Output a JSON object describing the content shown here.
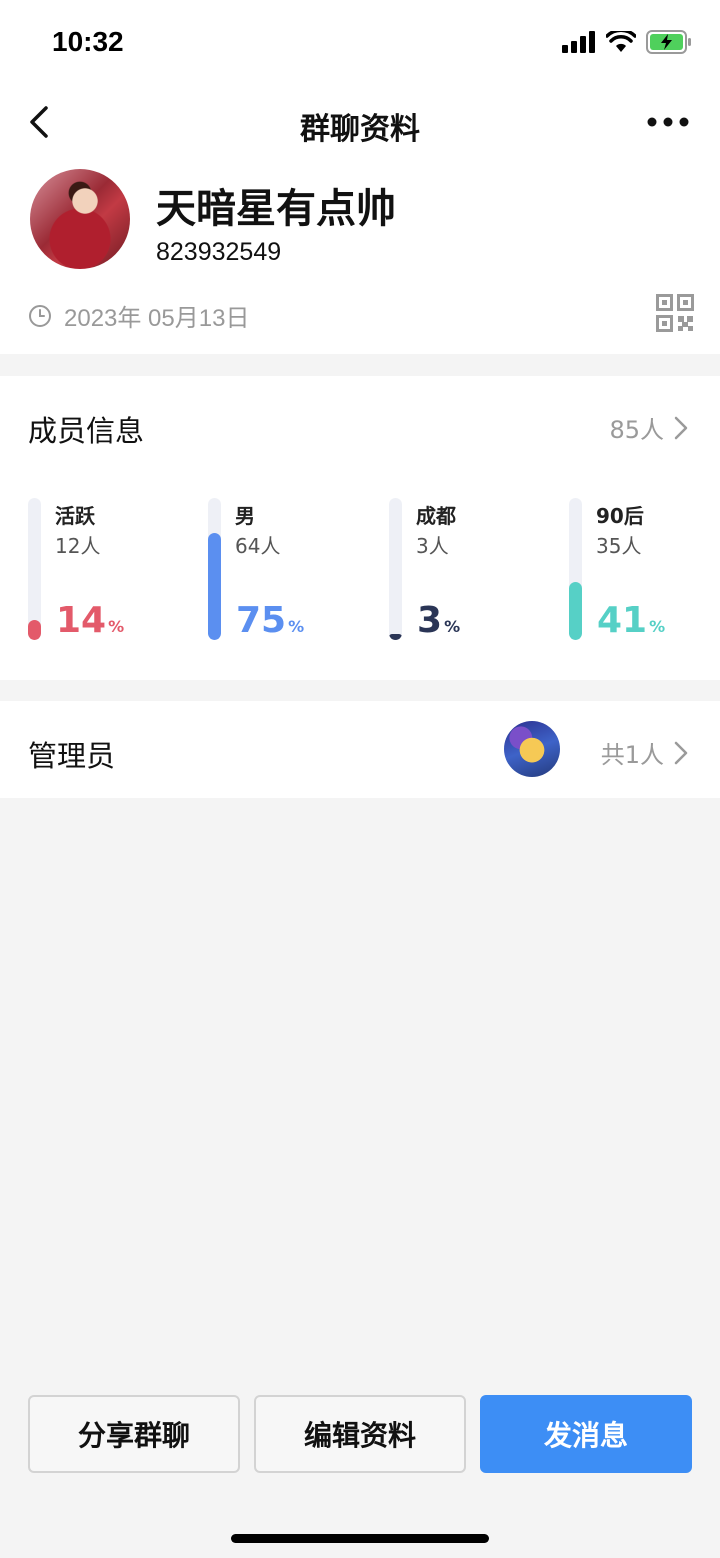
{
  "status_bar": {
    "time": "10:32"
  },
  "nav": {
    "title": "群聊资料"
  },
  "profile": {
    "name": "天暗星有点帅",
    "group_id": "823932549",
    "created_date": "2023年 05月13日"
  },
  "members": {
    "title": "成员信息",
    "count_label": "85人",
    "stats": [
      {
        "label": "活跃",
        "count": "12人",
        "percent": "14",
        "value": 0.14,
        "color": "#e35a6a"
      },
      {
        "label": "男",
        "count": "64人",
        "percent": "75",
        "value": 0.75,
        "color": "#5b8ff0"
      },
      {
        "label": "成都",
        "count": "3人",
        "percent": "3",
        "value": 0.03,
        "color": "#2a3556"
      },
      {
        "label": "90后",
        "count": "35人",
        "percent": "41",
        "value": 0.41,
        "color": "#56d0c6"
      }
    ],
    "percent_sign": "%"
  },
  "admins": {
    "title": "管理员",
    "count_label": "共1人"
  },
  "actions": {
    "share_label": "分享群聊",
    "edit_label": "编辑资料",
    "message_label": "发消息"
  }
}
